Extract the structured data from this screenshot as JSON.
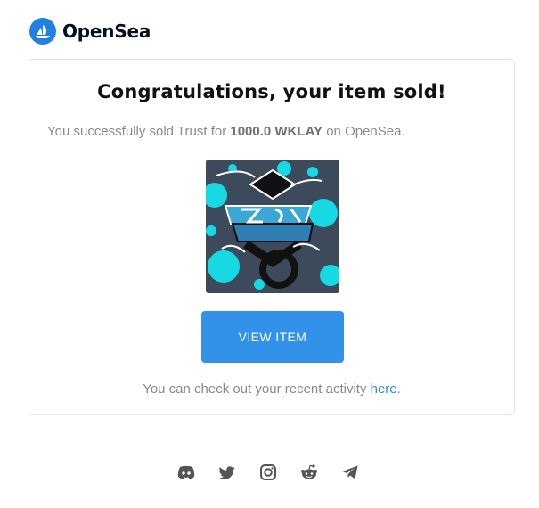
{
  "brand": {
    "name": "OpenSea",
    "logo_icon": "opensea-logo-icon",
    "accent": "#2081e2"
  },
  "email": {
    "title": "Congratulations, your item sold!",
    "sold_prefix": "You successfully sold Trust for ",
    "sold_price": "1000.0 WKLAY",
    "sold_suffix": " on OpenSea.",
    "image_alt_name": "nft-artwork",
    "button_label": "VIEW ITEM",
    "activity_prefix": "You can check out your recent activity ",
    "activity_link": "here",
    "activity_suffix": ".",
    "button_color": "#3291e9"
  },
  "footer": {
    "socials": [
      "discord-icon",
      "twitter-icon",
      "instagram-icon",
      "reddit-icon",
      "telegram-icon"
    ]
  }
}
